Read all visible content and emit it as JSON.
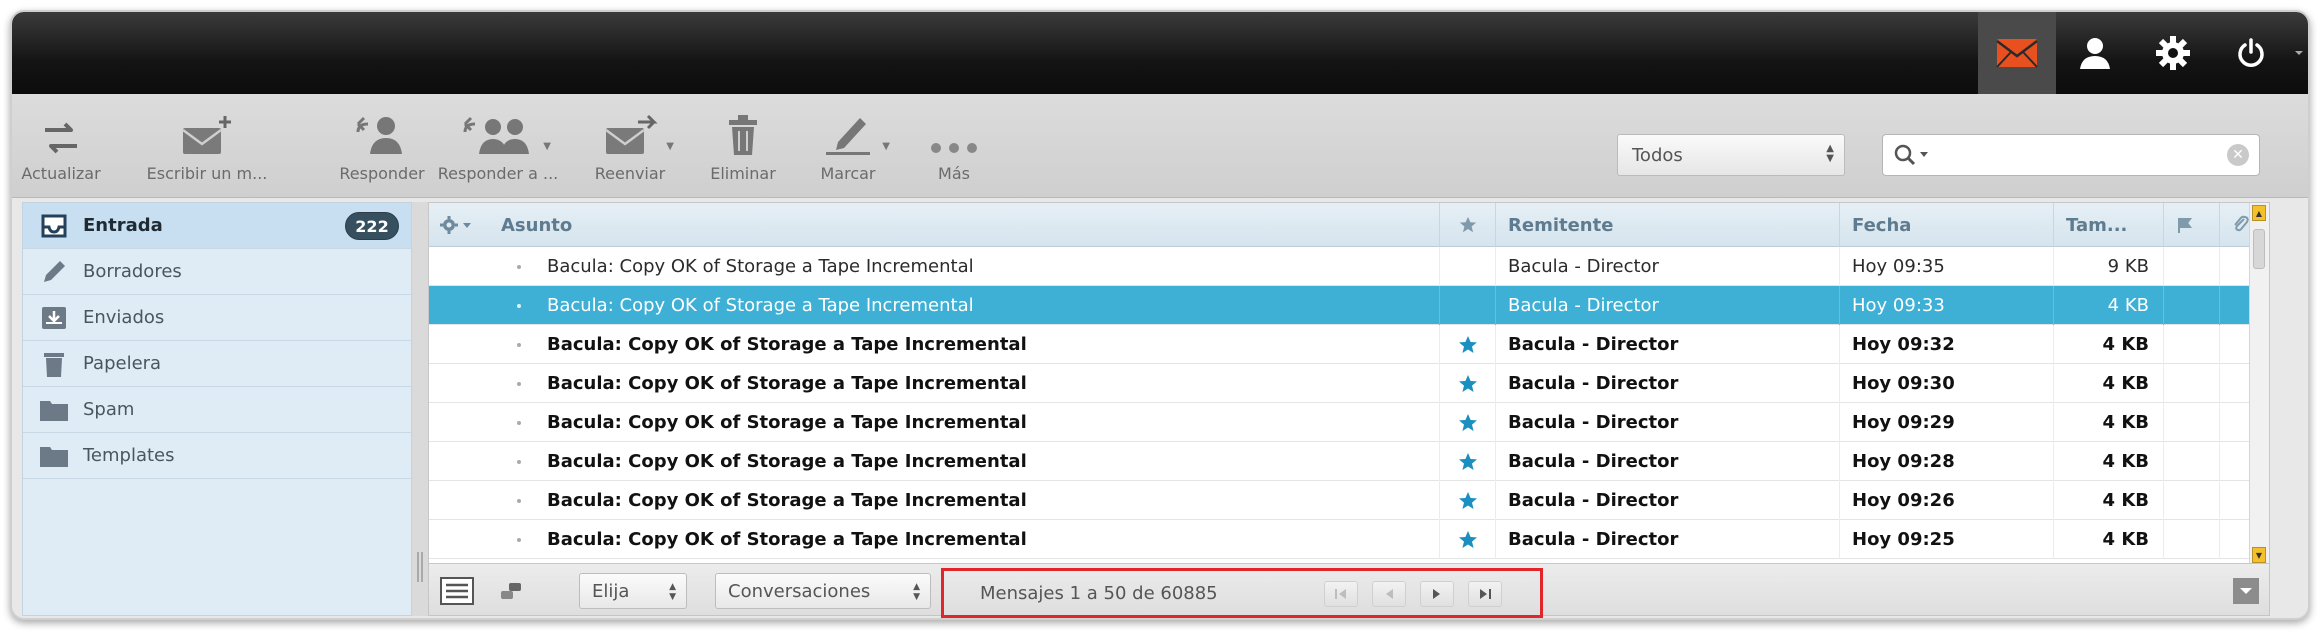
{
  "toolbar": {
    "refresh": "Actualizar",
    "compose": "Escribir un m...",
    "reply": "Responder",
    "reply_all": "Responder a ...",
    "forward": "Reenviar",
    "delete": "Eliminar",
    "mark": "Marcar",
    "more": "Más"
  },
  "filter": {
    "selected": "Todos"
  },
  "search": {
    "value": ""
  },
  "folders": [
    {
      "name": "Entrada",
      "count": "222",
      "icon": "inbox-icon"
    },
    {
      "name": "Borradores",
      "icon": "pencil-icon"
    },
    {
      "name": "Enviados",
      "icon": "sent-icon"
    },
    {
      "name": "Papelera",
      "icon": "trash-icon"
    },
    {
      "name": "Spam",
      "icon": "folder-icon"
    },
    {
      "name": "Templates",
      "icon": "folder-icon"
    }
  ],
  "columns": {
    "subject": "Asunto",
    "from": "Remitente",
    "date": "Fecha",
    "size": "Tam..."
  },
  "messages": [
    {
      "subject": "Bacula: Copy OK of Storage a Tape Incremental",
      "from": "Bacula - Director",
      "date": "Hoy 09:35",
      "size": "9 KB",
      "flagged": false,
      "unread": false,
      "selected": false
    },
    {
      "subject": "Bacula: Copy OK of Storage a Tape Incremental",
      "from": "Bacula - Director",
      "date": "Hoy 09:33",
      "size": "4 KB",
      "flagged": false,
      "unread": false,
      "selected": true
    },
    {
      "subject": "Bacula: Copy OK of Storage a Tape Incremental",
      "from": "Bacula - Director",
      "date": "Hoy 09:32",
      "size": "4 KB",
      "flagged": true,
      "unread": true,
      "selected": false
    },
    {
      "subject": "Bacula: Copy OK of Storage a Tape Incremental",
      "from": "Bacula - Director",
      "date": "Hoy 09:30",
      "size": "4 KB",
      "flagged": true,
      "unread": true,
      "selected": false
    },
    {
      "subject": "Bacula: Copy OK of Storage a Tape Incremental",
      "from": "Bacula - Director",
      "date": "Hoy 09:29",
      "size": "4 KB",
      "flagged": true,
      "unread": true,
      "selected": false
    },
    {
      "subject": "Bacula: Copy OK of Storage a Tape Incremental",
      "from": "Bacula - Director",
      "date": "Hoy 09:28",
      "size": "4 KB",
      "flagged": true,
      "unread": true,
      "selected": false
    },
    {
      "subject": "Bacula: Copy OK of Storage a Tape Incremental",
      "from": "Bacula - Director",
      "date": "Hoy 09:26",
      "size": "4 KB",
      "flagged": true,
      "unread": true,
      "selected": false
    },
    {
      "subject": "Bacula: Copy OK of Storage a Tape Incremental",
      "from": "Bacula - Director",
      "date": "Hoy 09:25",
      "size": "4 KB",
      "flagged": true,
      "unread": true,
      "selected": false
    }
  ],
  "footer": {
    "select": "Elija",
    "threads": "Conversaciones",
    "pager": "Mensajes 1 a 50 de 60885"
  },
  "colors": {
    "accent": "#e8501f",
    "selection": "#3eb0d6",
    "star": "#1a8fc0",
    "highlight_box": "#e0262b"
  }
}
